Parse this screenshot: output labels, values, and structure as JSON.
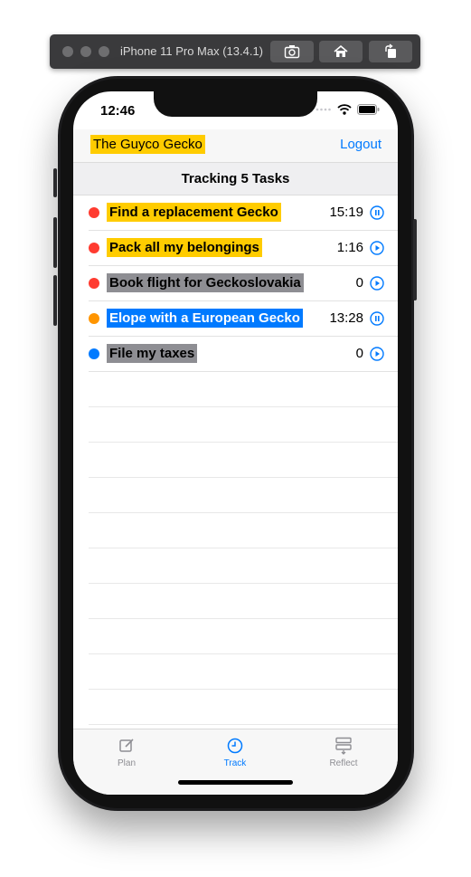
{
  "simulator": {
    "title": "iPhone 11 Pro Max (13.4.1)",
    "buttons": [
      "screenshot-icon",
      "home-icon",
      "rotate-icon"
    ]
  },
  "status_bar": {
    "time": "12:46"
  },
  "nav": {
    "title": "The Guyco Gecko",
    "logout": "Logout"
  },
  "section_header": "Tracking 5 Tasks",
  "tasks": [
    {
      "name": "Find a replacement Gecko",
      "dot": "#ff3b30",
      "label_bg": "#ffcc00",
      "label_color": "#000000",
      "time": "15:19",
      "state": "pause"
    },
    {
      "name": "Pack all my belongings",
      "dot": "#ff3b30",
      "label_bg": "#ffcc00",
      "label_color": "#000000",
      "time": "1:16",
      "state": "play"
    },
    {
      "name": "Book flight for Geckoslovakia",
      "dot": "#ff3b30",
      "label_bg": "#8e8e93",
      "label_color": "#000000",
      "time": "0",
      "state": "play"
    },
    {
      "name": "Elope with a European Gecko",
      "dot": "#ff9500",
      "label_bg": "#007aff",
      "label_color": "#ffffff",
      "time": "13:28",
      "state": "pause"
    },
    {
      "name": "File my taxes",
      "dot": "#007aff",
      "label_bg": "#8e8e93",
      "label_color": "#000000",
      "time": "0",
      "state": "play"
    }
  ],
  "tabs": [
    {
      "label": "Plan",
      "icon": "edit-icon",
      "active": false
    },
    {
      "label": "Track",
      "icon": "clock-icon",
      "active": true
    },
    {
      "label": "Reflect",
      "icon": "reflect-icon",
      "active": false
    }
  ],
  "colors": {
    "accent": "#007aff",
    "inactive": "#8e8e93",
    "highlight": "#ffcc00"
  }
}
